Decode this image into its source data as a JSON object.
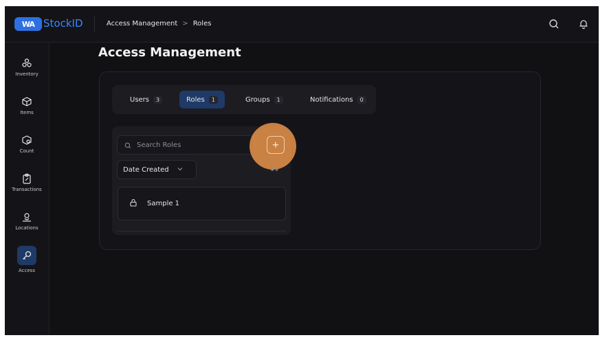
{
  "app": {
    "brand": "StockID",
    "logo_text": "WA"
  },
  "breadcrumb": {
    "parent": "Access Management",
    "separator": ">",
    "current": "Roles"
  },
  "topbar": {
    "icons": [
      "search-icon",
      "bell-icon"
    ]
  },
  "sidebar": {
    "items": [
      {
        "label": "Inventory",
        "icon": "inventory-icon",
        "active": false
      },
      {
        "label": "Items",
        "icon": "cube-icon",
        "active": false
      },
      {
        "label": "Count",
        "icon": "count-icon",
        "active": false
      },
      {
        "label": "Transactions",
        "icon": "clipboard-icon",
        "active": false
      },
      {
        "label": "Locations",
        "icon": "location-icon",
        "active": false
      },
      {
        "label": "Access",
        "icon": "key-icon",
        "active": true
      }
    ]
  },
  "page": {
    "title": "Access Management"
  },
  "tabs": [
    {
      "label": "Users",
      "count": "3",
      "active": false
    },
    {
      "label": "Roles",
      "count": "1",
      "active": true
    },
    {
      "label": "Groups",
      "count": "1",
      "active": false
    },
    {
      "label": "Notifications",
      "count": "0",
      "active": false
    }
  ],
  "roles": {
    "search_placeholder": "Search Roles",
    "add_label": "+",
    "sort_label": "Date Created",
    "sort_direction": "↓₉",
    "items": [
      {
        "name": "Sample 1",
        "icon": "lock-icon"
      }
    ]
  },
  "colors": {
    "accent": "#1f3a66",
    "brand": "#3a86ff",
    "highlight": "#e8934a",
    "background": "#111114"
  }
}
